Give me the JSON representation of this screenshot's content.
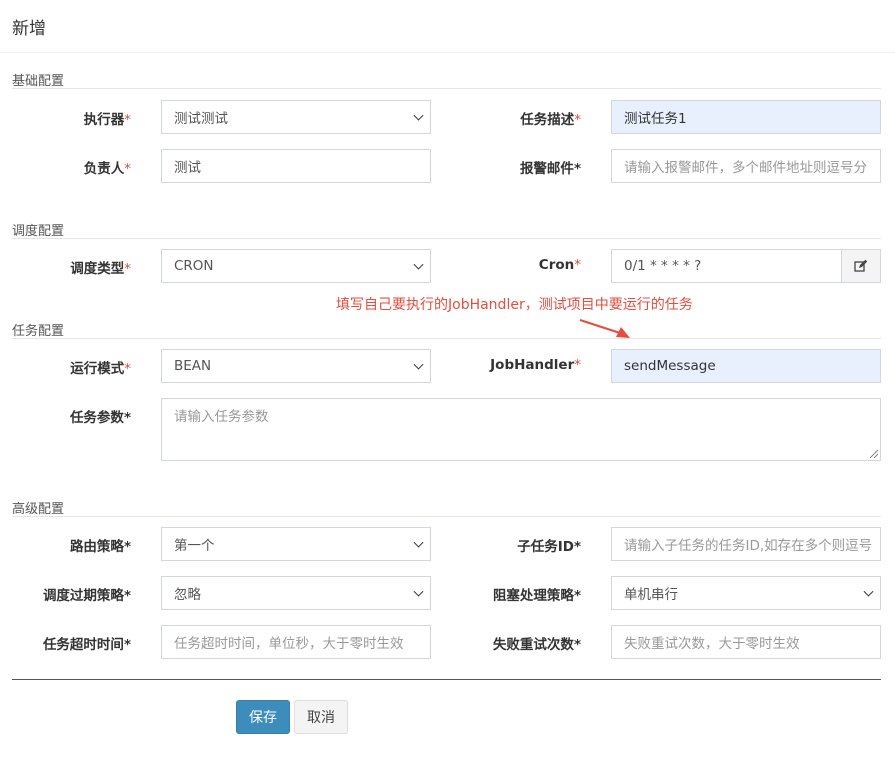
{
  "title": "新增",
  "sections": {
    "basic": "基础配置",
    "schedule": "调度配置",
    "job": "任务配置",
    "advanced": "高级配置"
  },
  "fields": {
    "executor": {
      "label": "执行器",
      "value": "测试测试"
    },
    "job_desc": {
      "label": "任务描述",
      "value": "测试任务1"
    },
    "author": {
      "label": "负责人",
      "value": "测试"
    },
    "alarm_email": {
      "label": "报警邮件",
      "placeholder": "请输入报警邮件，多个邮件地址则逗号分"
    },
    "schedule_type": {
      "label": "调度类型",
      "value": "CRON"
    },
    "cron": {
      "label": "Cron",
      "value": "0/1 * * * * ?"
    },
    "glue_type": {
      "label": "运行模式",
      "value": "BEAN"
    },
    "job_handler": {
      "label": "JobHandler",
      "value": "sendMessage"
    },
    "job_param": {
      "label": "任务参数",
      "placeholder": "请输入任务参数"
    },
    "route_strategy": {
      "label": "路由策略",
      "value": "第一个"
    },
    "child_job_id": {
      "label": "子任务ID",
      "placeholder": "请输入子任务的任务ID,如存在多个则逗号"
    },
    "misfire_strategy": {
      "label": "调度过期策略",
      "value": "忽略"
    },
    "block_strategy": {
      "label": "阻塞处理策略",
      "value": "单机串行"
    },
    "timeout": {
      "label": "任务超时时间",
      "placeholder": "任务超时时间，单位秒，大于零时生效"
    },
    "fail_retry": {
      "label": "失败重试次数",
      "placeholder": "失败重试次数，大于零时生效"
    }
  },
  "required_mark": "*",
  "annotation": "填写自己要执行的JobHandler，测试项目中要运行的任务",
  "buttons": {
    "save": "保存",
    "cancel": "取消"
  },
  "icons": {
    "cron_edit": "edit-icon"
  },
  "colors": {
    "primary": "#3c8dbc",
    "required": "#dd4b39",
    "annotation": "#e74c3c",
    "autofill": "#e8f0fe"
  }
}
